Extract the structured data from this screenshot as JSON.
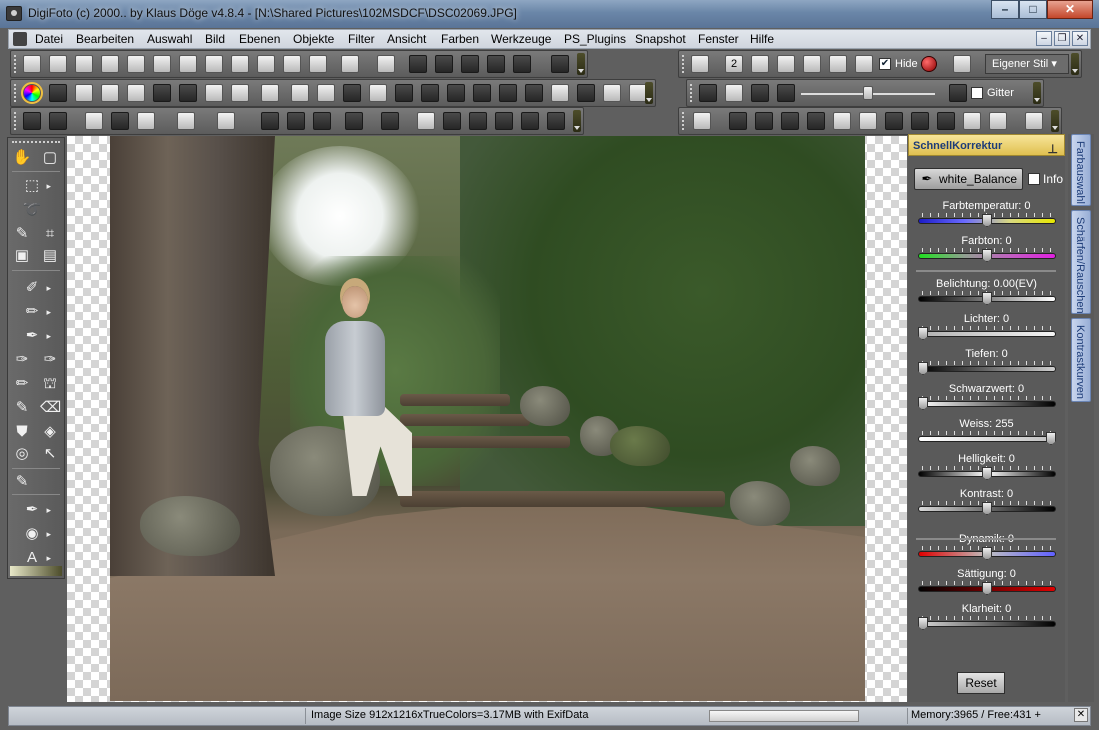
{
  "window": {
    "title": "DigiFoto (c) 2000.. by Klaus Döge v4.8.4 - [N:\\Shared Pictures\\102MSDCF\\DSC02069.JPG]",
    "controls": [
      "minimize-icon",
      "maximize-icon",
      "close-icon"
    ]
  },
  "menu": {
    "items": [
      "Datei",
      "Bearbeiten",
      "Auswahl",
      "Bild",
      "Ebenen",
      "Objekte",
      "Filter",
      "Ansicht",
      "Farben",
      "Werkzeuge",
      "PS_Plugins",
      "Snapshot",
      "Fenster",
      "Hilfe"
    ]
  },
  "toolbar": {
    "page_num": "2",
    "hide_label": "Hide",
    "hide_checked": true,
    "style_label": "Eigener Stil",
    "gitter_label": "Gitter",
    "zoom_level": 0.55
  },
  "panel": {
    "title": "SchnellKorrektur",
    "white_balance_label": "white_Balance",
    "info_label": "Info",
    "sliders": [
      {
        "label": "Farbtemperatur: 0",
        "position": 0.5,
        "gradient": "blue-yellow"
      },
      {
        "label": "Farbton: 0",
        "position": 0.5,
        "gradient": "green-magenta"
      },
      {
        "label": "Belichtung: 0.00(EV)",
        "position": 0.5,
        "gradient": "black-white"
      },
      {
        "label": "Lichter: 0",
        "position": 0.0,
        "gradient": "gray"
      },
      {
        "label": "Tiefen: 0",
        "position": 0.0,
        "gradient": "black-gray"
      },
      {
        "label": "Schwarzwert: 0",
        "position": 0.0,
        "gradient": "white-black"
      },
      {
        "label": "Weiss: 255",
        "position": 1.0,
        "gradient": "white-gray"
      },
      {
        "label": "Helligkeit: 0",
        "position": 0.5,
        "gradient": "black-white-black"
      },
      {
        "label": "Kontrast: 0",
        "position": 0.5,
        "gradient": "gray-black"
      },
      {
        "label": "Dynamik: 0",
        "position": 0.5,
        "gradient": "red-blue"
      },
      {
        "label": "Sättigung: 0",
        "position": 0.5,
        "gradient": "black-red"
      },
      {
        "label": "Klarheit: 0",
        "position": 0.0,
        "gradient": "gray-black"
      }
    ],
    "reset_label": "Reset"
  },
  "side_tabs": [
    "Farbauswahl",
    "Schärfen/Rauschen",
    "Kontrastkurven"
  ],
  "status": {
    "image_info": "Image Size 912x1216xTrueColors=3.17MB  with ExifData",
    "memory": "Memory:3965 / Free:431  +"
  },
  "colors": {
    "panel_header": "#e0c050",
    "selected_tool": "#f0c040"
  }
}
